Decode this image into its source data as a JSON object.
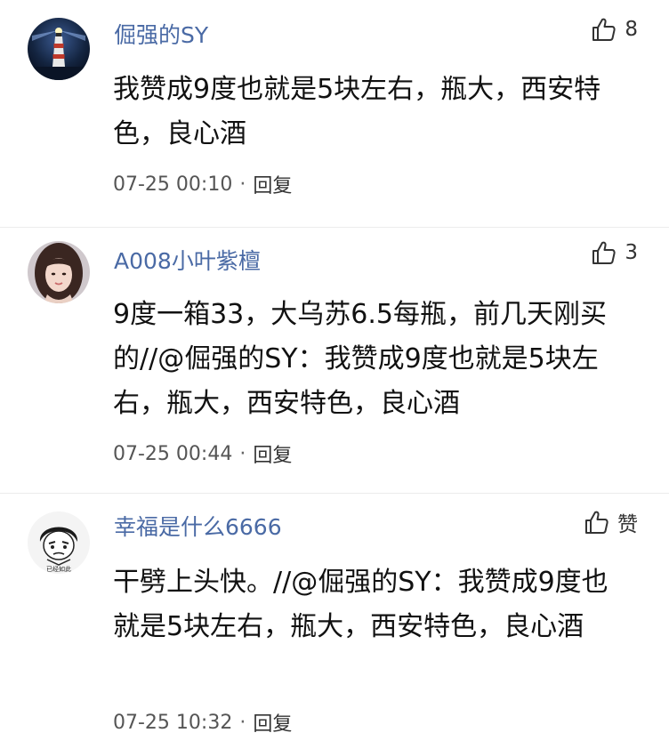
{
  "comments": [
    {
      "username": "倔强的SY",
      "likes": "8",
      "text": "我赞成9度也就是5块左右，瓶大，西安特色，良心酒",
      "time": "07-25 00:10",
      "reply_label": "回复",
      "avatar_icon": "lighthouse-avatar"
    },
    {
      "username": "A008小叶紫檀",
      "likes": "3",
      "text": "9度一箱33，大乌苏6.5每瓶，前几天刚买的//@倔强的SY：我赞成9度也就是5块左右，瓶大，西安特色，良心酒",
      "time": "07-25 00:44",
      "reply_label": "回复",
      "avatar_icon": "woman-portrait-avatar"
    },
    {
      "username": "幸福是什么6666",
      "likes": "赞",
      "text": "干劈上头快。//@倔强的SY：我赞成9度也就是5块左右，瓶大，西安特色，良心酒",
      "time": "07-25 10:32",
      "reply_label": "回复",
      "avatar_icon": "cartoon-meme-avatar",
      "avatar_caption": "已经如此"
    }
  ],
  "separator": "·",
  "colors": {
    "username": "#4a6aa5",
    "text": "#111111",
    "meta": "#555555",
    "divider": "#ececec"
  }
}
